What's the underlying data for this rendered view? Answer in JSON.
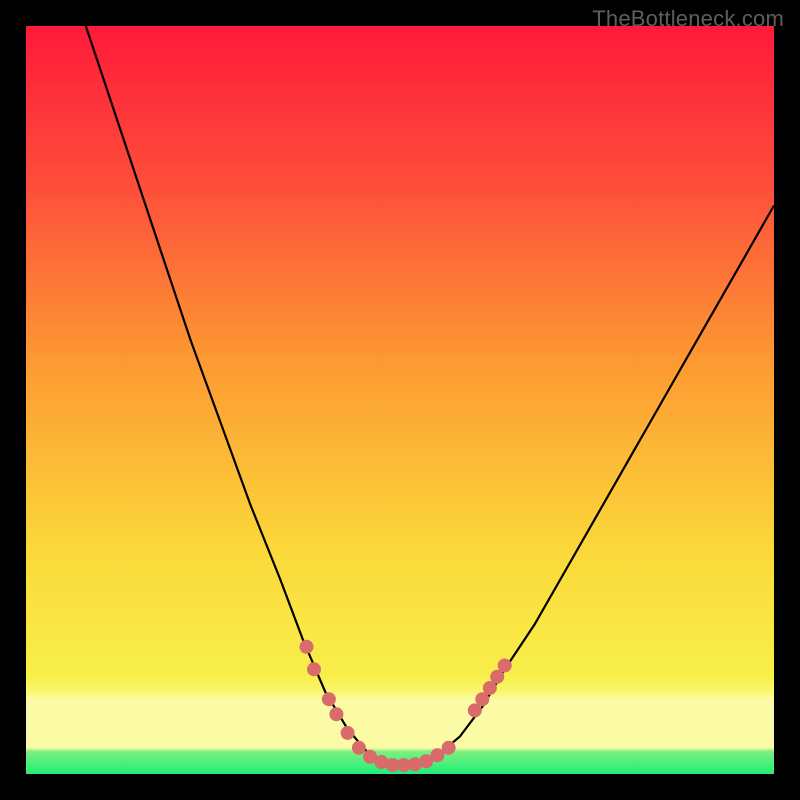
{
  "watermark": "TheBottleneck.com",
  "colors": {
    "gradient_top": "#fe1a3a",
    "gradient_mid1": "#fd8b2f",
    "gradient_mid2": "#f9e53e",
    "gradient_bottom_band": "#fafaa2",
    "gradient_green": "#2bef7a",
    "curve_stroke": "#000000",
    "dot_fill": "#d96b6a",
    "frame_bg": "#000000"
  },
  "chart_data": {
    "type": "line",
    "title": "",
    "xlabel": "",
    "ylabel": "",
    "x_range": [
      0,
      100
    ],
    "y_range": [
      0,
      100
    ],
    "curve": [
      {
        "x": 8,
        "y": 100
      },
      {
        "x": 10,
        "y": 94
      },
      {
        "x": 14,
        "y": 82
      },
      {
        "x": 18,
        "y": 70
      },
      {
        "x": 22,
        "y": 58
      },
      {
        "x": 26,
        "y": 47
      },
      {
        "x": 30,
        "y": 36
      },
      {
        "x": 34,
        "y": 26
      },
      {
        "x": 37,
        "y": 18
      },
      {
        "x": 40,
        "y": 11
      },
      {
        "x": 43,
        "y": 6
      },
      {
        "x": 46,
        "y": 2.5
      },
      {
        "x": 49,
        "y": 1.2
      },
      {
        "x": 52,
        "y": 1.2
      },
      {
        "x": 55,
        "y": 2.5
      },
      {
        "x": 58,
        "y": 5
      },
      {
        "x": 61,
        "y": 9
      },
      {
        "x": 64,
        "y": 14
      },
      {
        "x": 68,
        "y": 20
      },
      {
        "x": 72,
        "y": 27
      },
      {
        "x": 76,
        "y": 34
      },
      {
        "x": 80,
        "y": 41
      },
      {
        "x": 84,
        "y": 48
      },
      {
        "x": 88,
        "y": 55
      },
      {
        "x": 92,
        "y": 62
      },
      {
        "x": 96,
        "y": 69
      },
      {
        "x": 100,
        "y": 76
      }
    ],
    "dots": [
      {
        "x": 37.5,
        "y": 17
      },
      {
        "x": 38.5,
        "y": 14
      },
      {
        "x": 40.5,
        "y": 10
      },
      {
        "x": 41.5,
        "y": 8
      },
      {
        "x": 43.0,
        "y": 5.5
      },
      {
        "x": 44.5,
        "y": 3.5
      },
      {
        "x": 46.0,
        "y": 2.3
      },
      {
        "x": 47.5,
        "y": 1.6
      },
      {
        "x": 49.0,
        "y": 1.2
      },
      {
        "x": 50.5,
        "y": 1.2
      },
      {
        "x": 52.0,
        "y": 1.3
      },
      {
        "x": 53.5,
        "y": 1.7
      },
      {
        "x": 55.0,
        "y": 2.5
      },
      {
        "x": 56.5,
        "y": 3.5
      },
      {
        "x": 60.0,
        "y": 8.5
      },
      {
        "x": 61.0,
        "y": 10
      },
      {
        "x": 62.0,
        "y": 11.5
      },
      {
        "x": 63.0,
        "y": 13
      },
      {
        "x": 64.0,
        "y": 14.5
      }
    ],
    "bottom_bands_pct_from_bottom": {
      "pale_yellow_band_top": 10,
      "green_band_top": 2
    }
  }
}
